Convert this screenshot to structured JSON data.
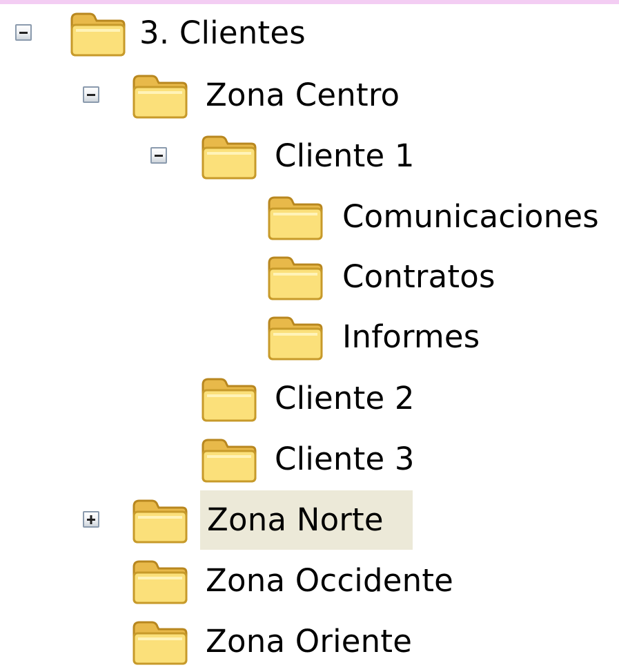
{
  "tree": {
    "nodes": [
      {
        "label": "3. Clientes",
        "expander": "minus",
        "icon": "folder-open-icon",
        "selected": false
      },
      {
        "label": "Zona Centro",
        "expander": "minus",
        "icon": "folder-open-icon",
        "selected": false
      },
      {
        "label": "Cliente 1",
        "expander": "minus",
        "icon": "folder-open-icon",
        "selected": false
      },
      {
        "label": "Comunicaciones",
        "expander": "none",
        "icon": "folder-icon",
        "selected": false
      },
      {
        "label": "Contratos",
        "expander": "none",
        "icon": "folder-icon",
        "selected": false
      },
      {
        "label": "Informes",
        "expander": "none",
        "icon": "folder-icon",
        "selected": false
      },
      {
        "label": "Cliente 2",
        "expander": "none",
        "icon": "folder-icon",
        "selected": false
      },
      {
        "label": "Cliente 3",
        "expander": "none",
        "icon": "folder-icon",
        "selected": false
      },
      {
        "label": "Zona Norte",
        "expander": "plus",
        "icon": "folder-icon",
        "selected": true
      },
      {
        "label": "Zona Occidente",
        "expander": "none",
        "icon": "folder-icon",
        "selected": false
      },
      {
        "label": "Zona Oriente",
        "expander": "none",
        "icon": "folder-icon",
        "selected": false
      }
    ]
  },
  "colors": {
    "selection_background": "#ece9d8",
    "folder_fill": "#f8d760",
    "folder_outline": "#c79a2a",
    "expander_border": "#8a9aad",
    "top_strip": "#f3cdf3"
  }
}
